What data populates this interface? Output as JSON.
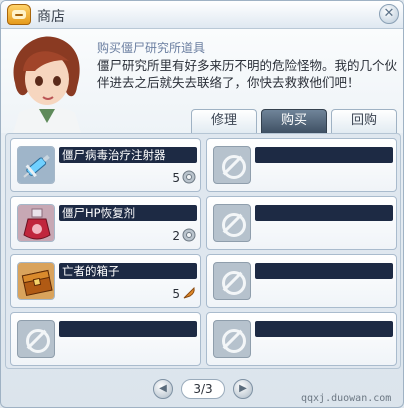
{
  "window": {
    "title": "商店"
  },
  "dialog": {
    "title": "购买僵尸研究所道具",
    "text": "僵尸研究所里有好多来历不明的危险怪物。我的几个伙伴进去之后就失去联络了，你快去救救他们吧！"
  },
  "tabs": [
    {
      "label": "修理",
      "active": false
    },
    {
      "label": "购买",
      "active": true
    },
    {
      "label": "回购",
      "active": false
    }
  ],
  "items": [
    {
      "name": "僵尸病毒治疗注射器",
      "price": "5",
      "icon": "syringe-icon",
      "currency_icon": "gear-coin-icon",
      "empty": false
    },
    {
      "name": "",
      "empty": true
    },
    {
      "name": "僵尸HP恢复剂",
      "price": "2",
      "icon": "potion-icon",
      "currency_icon": "gear-coin-icon",
      "empty": false
    },
    {
      "name": "",
      "empty": true
    },
    {
      "name": "亡者的箱子",
      "price": "5",
      "icon": "chest-icon",
      "currency_icon": "feather-icon",
      "empty": false
    },
    {
      "name": "",
      "empty": true
    },
    {
      "name": "",
      "empty": true
    },
    {
      "name": "",
      "empty": true
    }
  ],
  "pager": {
    "label": "3/3"
  },
  "watermark": "qqxj.duowan.com",
  "colors": {
    "accent": "#3f5063",
    "name_bar": "#1d2a44"
  }
}
